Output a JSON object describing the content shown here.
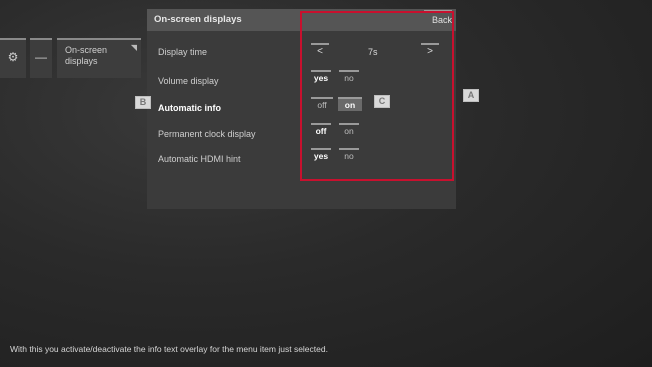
{
  "sidebar": {
    "gear_glyph": "⚙",
    "dash_glyph": "—",
    "item_label": "On-screen displays"
  },
  "panel": {
    "title": "On-screen displays",
    "back_label": "Back"
  },
  "settings": [
    {
      "label": "Display time",
      "prev": "<",
      "value": "7s",
      "next": ">"
    },
    {
      "label": "Volume display",
      "options": [
        "yes",
        "no"
      ],
      "selected": "yes"
    },
    {
      "label": "Automatic info",
      "options": [
        "off",
        "on"
      ],
      "selected": "on"
    },
    {
      "label": "Permanent clock display",
      "options": [
        "off",
        "on"
      ],
      "selected": "off"
    },
    {
      "label": "Automatic HDMI hint",
      "options": [
        "yes",
        "no"
      ],
      "selected": "yes"
    }
  ],
  "markers": {
    "a": "A",
    "b": "B",
    "c": "C"
  },
  "footer": "With this you activate/deactivate the info text overlay for the menu item just selected.",
  "colors": {
    "highlight_box": "#c8102e"
  }
}
